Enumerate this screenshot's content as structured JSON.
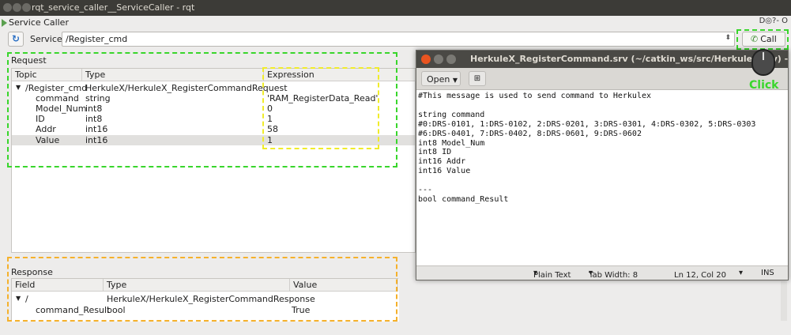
{
  "window": {
    "title": "rqt_service_caller__ServiceCaller - rqt"
  },
  "plugin": {
    "title": "Service Caller",
    "header_icons": "D◎?- O"
  },
  "toolbar": {
    "service_label": "Service",
    "service_value": "/Register_cmd",
    "call_label": "Call"
  },
  "request": {
    "label": "Request",
    "columns": [
      "Topic",
      "Type",
      "Expression"
    ],
    "root": {
      "name": "/Register_cmd",
      "type": "HerkuleX/HerkuleX_RegisterCommandRequest"
    },
    "rows": [
      {
        "topic": "command",
        "type": "string",
        "expr": "'RAM_RegisterData_Read'"
      },
      {
        "topic": "Model_Num",
        "type": "int8",
        "expr": "0"
      },
      {
        "topic": "ID",
        "type": "int8",
        "expr": "1"
      },
      {
        "topic": "Addr",
        "type": "int16",
        "expr": "58"
      },
      {
        "topic": "Value",
        "type": "int16",
        "expr": "1"
      }
    ]
  },
  "response": {
    "label": "Response",
    "columns": [
      "Field",
      "Type",
      "Value"
    ],
    "root": {
      "name": "/",
      "type": "HerkuleX/HerkuleX_RegisterCommandResponse"
    },
    "rows": [
      {
        "field": "command_Result",
        "type": "bool",
        "value": "True"
      }
    ]
  },
  "gedit": {
    "title": "HerkuleX_RegisterCommand.srv (~/catkin_ws/src/HerkuleX/srv) - gedit",
    "open_label": "Open",
    "lines": [
      "#This message is used to send command to Herkulex",
      "",
      "string command",
      "#0:DRS-0101, 1:DRS-0102, 2:DRS-0201, 3:DRS-0301, 4:DRS-0302, 5:DRS-0303",
      "#6:DRS-0401, 7:DRS-0402, 8:DRS-0601, 9:DRS-0602",
      "int8 Model_Num",
      "int8 ID",
      "int16 Addr",
      "int16 Value",
      "",
      "---",
      "bool command_Result"
    ],
    "status": {
      "syntax": "Plain Text",
      "tab_width": "Tab Width: 8",
      "position": "Ln 12, Col 20",
      "mode": "INS"
    }
  },
  "annotation": {
    "click_label": "Click"
  },
  "colors": {
    "green": "#39d62c",
    "yellow": "#f0ec2a",
    "orange": "#f5b12c"
  }
}
